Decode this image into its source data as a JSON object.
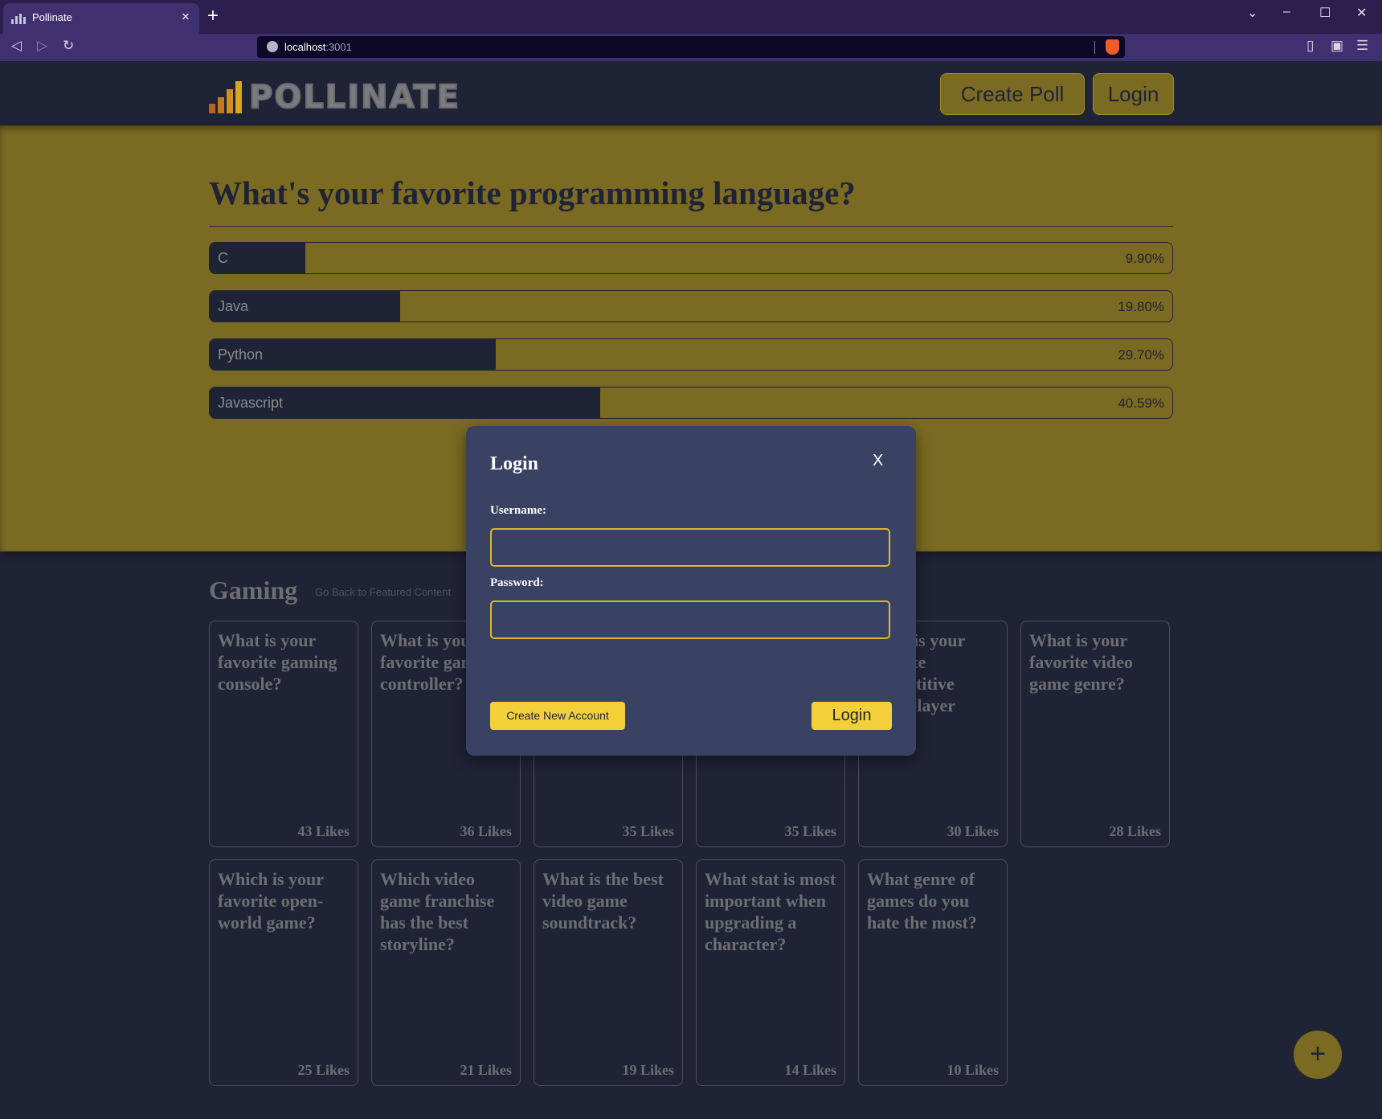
{
  "browser": {
    "tab_title": "Pollinate",
    "tab_close": "×",
    "new_tab": "+",
    "url_host": "localhost",
    "url_port": ":3001",
    "controls": {
      "back": "◁",
      "forward": "▷",
      "reload": "↻",
      "minimize": "–",
      "maximize": "☐",
      "close": "✕",
      "dropdown": "⌄",
      "sidebar": "▯",
      "wallet": "▣",
      "menu": "☰"
    }
  },
  "header": {
    "logo": "POLLINATE",
    "create_poll": "Create Poll",
    "login": "Login"
  },
  "featured_poll": {
    "question": "What's your favorite programming language?",
    "options": [
      {
        "label": "C",
        "percent_text": "9.90%",
        "share": 0.099
      },
      {
        "label": "Java",
        "percent_text": "19.80%",
        "share": 0.198
      },
      {
        "label": "Python",
        "percent_text": "29.70%",
        "share": 0.297
      },
      {
        "label": "Javascript",
        "percent_text": "40.59%",
        "share": 0.4059
      }
    ]
  },
  "section": {
    "title": "Gaming",
    "back_link": "Go Back to Featured Content"
  },
  "cards": [
    {
      "question": "What is your favorite gaming console?",
      "likes": "43 Likes"
    },
    {
      "question": "What is your favorite gaming controller?",
      "likes": "36 Likes"
    },
    {
      "question": "",
      "likes": "35 Likes"
    },
    {
      "question": "",
      "likes": "35 Likes"
    },
    {
      "question": "What is your favorite competitive multiplayer game?",
      "likes": "30 Likes"
    },
    {
      "question": "What is your favorite video game genre?",
      "likes": "28 Likes"
    },
    {
      "question": "Which is your favorite open-world game?",
      "likes": "25 Likes"
    },
    {
      "question": "Which video game franchise has the best storyline?",
      "likes": "21 Likes"
    },
    {
      "question": "What is the best video game soundtrack?",
      "likes": "19 Likes"
    },
    {
      "question": "What stat is most important when upgrading a character?",
      "likes": "14 Likes"
    },
    {
      "question": "What genre of games do you hate the most?",
      "likes": "10 Likes"
    }
  ],
  "fab": "+",
  "modal": {
    "title": "Login",
    "close": "X",
    "username_label": "Username:",
    "username_value": "",
    "password_label": "Password:",
    "password_value": "",
    "create_account": "Create New Account",
    "login": "Login"
  },
  "colors": {
    "page_bg": "#1f2336",
    "accent_gold": "#7a6a22",
    "modal_bg": "#3a4264",
    "button_yellow": "#f3d03a"
  }
}
